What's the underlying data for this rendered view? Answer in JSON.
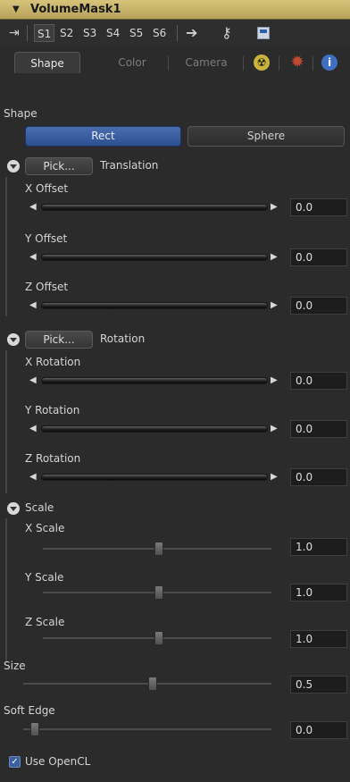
{
  "title": "VolumeMask1",
  "toolbar": {
    "slots": [
      "S1",
      "S2",
      "S3",
      "S4",
      "S5",
      "S6"
    ],
    "active_slot": "S1"
  },
  "tabs": {
    "items": [
      "Shape",
      "Color",
      "Camera"
    ],
    "active": "Shape"
  },
  "shape": {
    "section_label": "Shape",
    "options": [
      "Rect",
      "Sphere"
    ],
    "selected": "Rect"
  },
  "translation": {
    "pick_label": "Pick...",
    "group_label": "Translation",
    "params": [
      {
        "label": "X Offset",
        "value": "0.0"
      },
      {
        "label": "Y Offset",
        "value": "0.0"
      },
      {
        "label": "Z Offset",
        "value": "0.0"
      }
    ]
  },
  "rotation": {
    "pick_label": "Pick...",
    "group_label": "Rotation",
    "params": [
      {
        "label": "X Rotation",
        "value": "0.0"
      },
      {
        "label": "Y Rotation",
        "value": "0.0"
      },
      {
        "label": "Z Rotation",
        "value": "0.0"
      }
    ]
  },
  "scale": {
    "group_label": "Scale",
    "params": [
      {
        "label": "X Scale",
        "value": "1.0"
      },
      {
        "label": "Y Scale",
        "value": "1.0"
      },
      {
        "label": "Z Scale",
        "value": "1.0"
      }
    ]
  },
  "size": {
    "label": "Size",
    "value": "0.5"
  },
  "soft_edge": {
    "label": "Soft Edge",
    "value": "0.0"
  },
  "use_opencl": {
    "label": "Use OpenCL",
    "checked": true
  },
  "colors": {
    "title_bar": "#c9b46a",
    "selected_button": "#3a5ea0"
  }
}
